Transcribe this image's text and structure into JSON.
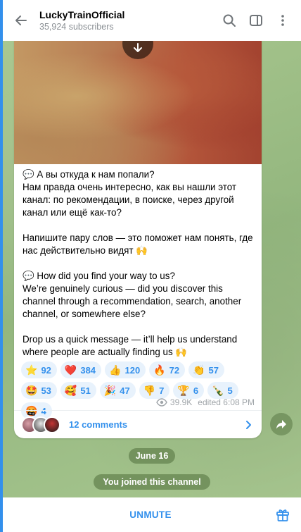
{
  "header": {
    "title": "LuckyTrainOfficial",
    "subscribers": "35,924 subscribers",
    "icons": [
      "back-arrow-icon",
      "search-icon",
      "sidebar-toggle-icon",
      "more-vert-icon"
    ]
  },
  "message": {
    "text_ru_1": "💬 А вы откуда к нам попали?\nНам правда очень интересно, как вы нашли этот канал: по рекомендации, в поиске, через другой канал или ещё как-то?",
    "text_ru_2": "Напишите пару слов — это поможет нам понять, где нас действительно видят 🙌",
    "text_en_1": "💬 How did you find your way to us?\nWe’re genuinely curious — did you discover this channel through a recommendation, search, another channel, or somewhere else?",
    "text_en_2": "Drop us a quick message — it’ll help us understand where people are actually finding us 🙌",
    "reactions": [
      {
        "emoji": "⭐",
        "count": "92"
      },
      {
        "emoji": "❤️",
        "count": "384"
      },
      {
        "emoji": "👍",
        "count": "120"
      },
      {
        "emoji": "🔥",
        "count": "72"
      },
      {
        "emoji": "👏",
        "count": "57"
      },
      {
        "emoji": "🤩",
        "count": "53"
      },
      {
        "emoji": "🥰",
        "count": "51"
      },
      {
        "emoji": "🎉",
        "count": "47"
      },
      {
        "emoji": "👎",
        "count": "7"
      },
      {
        "emoji": "🏆",
        "count": "6"
      },
      {
        "emoji": "🍾",
        "count": "5"
      },
      {
        "emoji": "🤬",
        "count": "4"
      }
    ],
    "views": "39.9K",
    "edited": "edited 6:08 PM",
    "comments_label": "12 comments"
  },
  "service": {
    "date": "June 16",
    "joined": "You joined this channel"
  },
  "bottom": {
    "unmute_label": "UNMUTE"
  },
  "colors": {
    "accent": "#3390ec",
    "reaction_bg": "#e8f2fc",
    "chat_bg": "#9fbf8a"
  }
}
